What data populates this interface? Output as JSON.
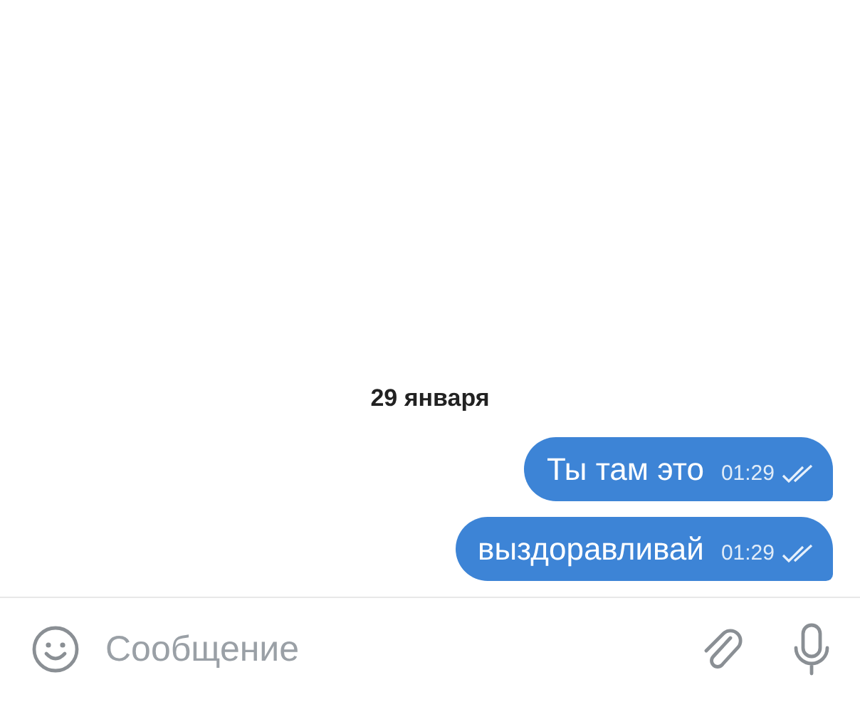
{
  "date_separator": "29 января",
  "messages": [
    {
      "text": "Ты там это",
      "time": "01:29",
      "read": true
    },
    {
      "text": "выздоравливай",
      "time": "01:29",
      "read": true
    }
  ],
  "composer": {
    "placeholder": "Сообщение"
  }
}
